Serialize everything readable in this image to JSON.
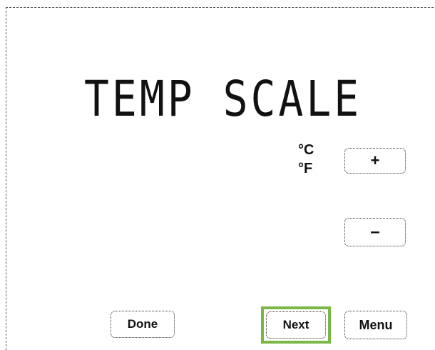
{
  "screen": {
    "title": "TEMP SCALE"
  },
  "units": {
    "celsius": "°C",
    "fahrenheit": "°F"
  },
  "controls": {
    "plus_label": "+",
    "minus_label": "–"
  },
  "footer": {
    "done_label": "Done",
    "next_label": "Next",
    "menu_label": "Menu"
  },
  "colors": {
    "highlight": "#7ab648"
  }
}
